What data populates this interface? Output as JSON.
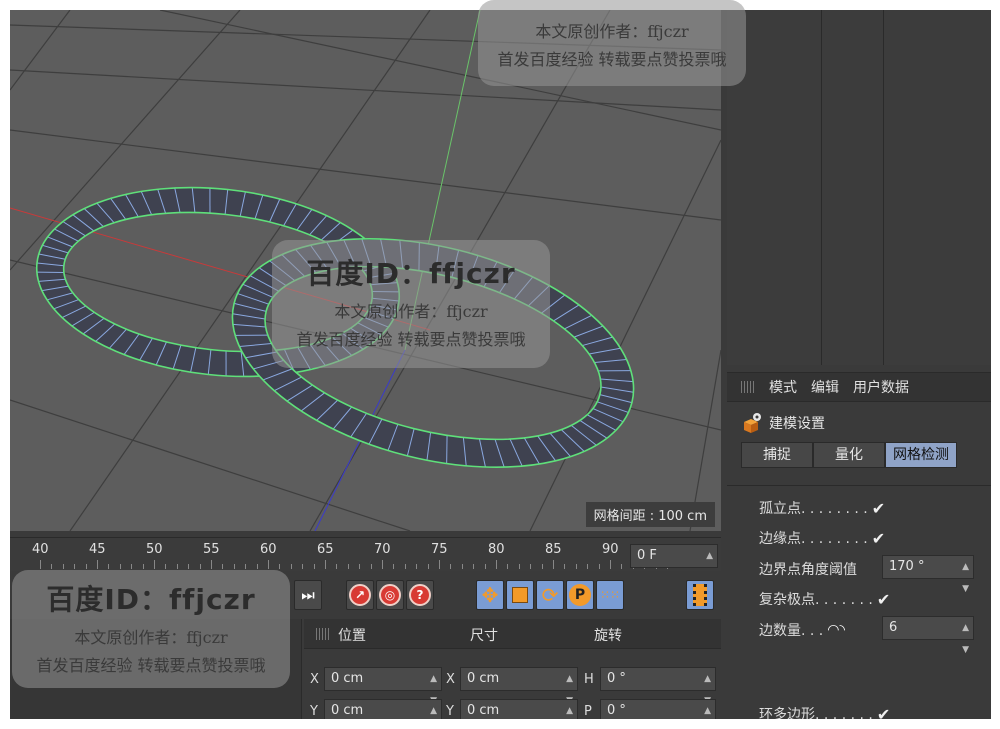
{
  "viewport": {
    "grid_spacing": "网格间距 : 100 cm"
  },
  "attributes": {
    "tabs": [
      "模式",
      "编辑",
      "用户数据"
    ],
    "section_title": "建模设置",
    "subtabs": [
      "捕捉",
      "量化",
      "网格检测"
    ],
    "properties": {
      "isolated_points": "孤立点. . . . . . . .",
      "border_points": "边缘点. . . . . . . .",
      "border_angle_label": "边界点角度阈值",
      "border_angle_value": "170 °",
      "complex_poles": "复杂极点. . . . . . .",
      "edge_count_label": "边数量. . .",
      "edge_count_value": "6",
      "bottom_cut": "环多边形. . . . . . ."
    },
    "check_mark": "✔"
  },
  "timeline": {
    "ticks": [
      "40",
      "45",
      "50",
      "55",
      "60",
      "65",
      "70",
      "75",
      "80",
      "85",
      "90"
    ],
    "current_frame": "0 F"
  },
  "coordinates": {
    "headers": [
      "位置",
      "尺寸",
      "旋转"
    ],
    "rows": [
      {
        "pos_axis": "X",
        "pos": "0 cm",
        "size_axis": "X",
        "size": "0 cm",
        "rot_axis": "H",
        "rot": "0 °"
      },
      {
        "pos_axis": "Y",
        "pos": "0 cm",
        "size_axis": "Y",
        "size": "0 cm",
        "rot_axis": "P",
        "rot": "0 °"
      }
    ]
  },
  "watermark": {
    "brand": "百度ID：ffjczr",
    "author": "本文原创作者：ffjczr",
    "slogan": "首发百度经验 转载要点赞投票哦"
  },
  "colors": {
    "ring_outline": "#5fe07a",
    "ring_fill": "#3f4250",
    "ring_segment": "#8aa8e0",
    "axis_x": "#c83a3a",
    "axis_y": "#6ac46a",
    "axis_z": "#3a3acc",
    "viewport_bg": "#5d5d5d",
    "accent_blue": "#7a9cd4"
  }
}
